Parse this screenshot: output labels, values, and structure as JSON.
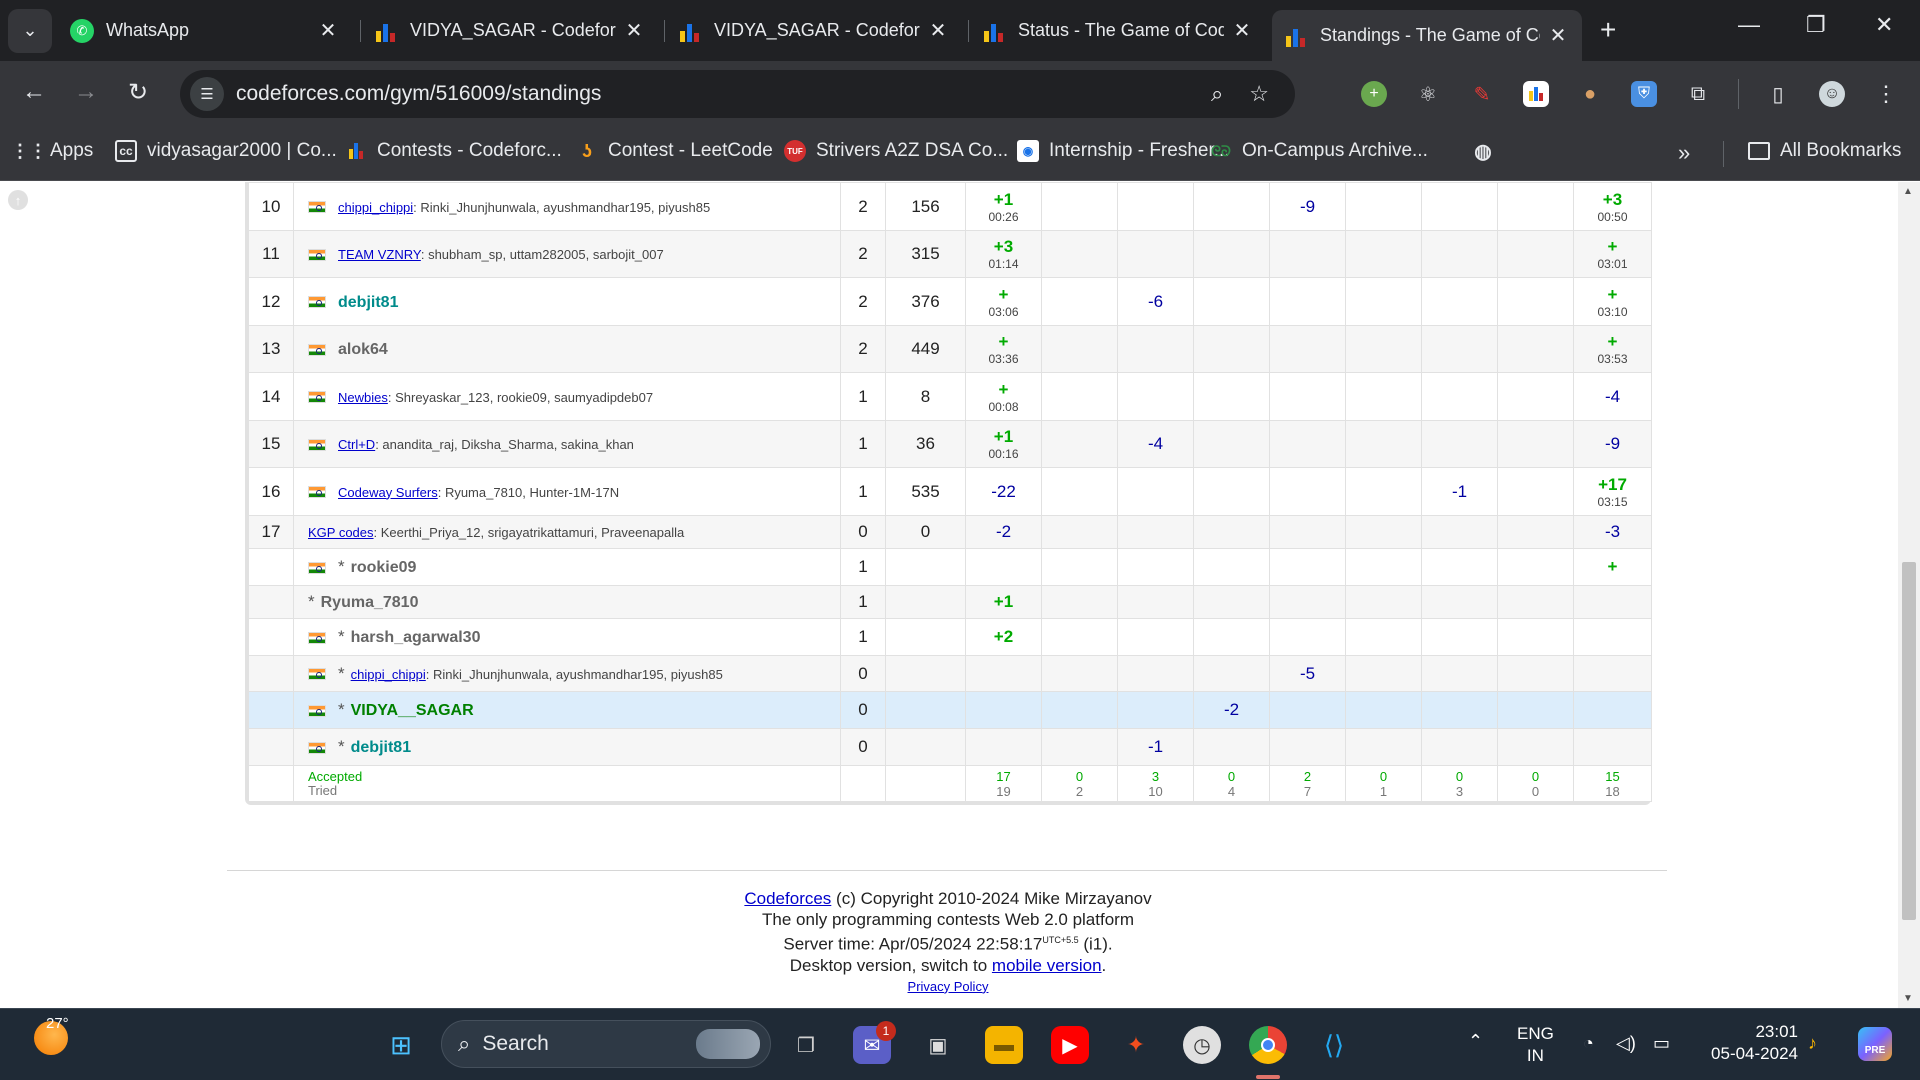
{
  "tabs": [
    {
      "title": "WhatsApp",
      "icon": "whatsapp-icon"
    },
    {
      "title": "VIDYA_SAGAR - Codeforces",
      "icon": "codeforces-icon"
    },
    {
      "title": "VIDYA_SAGAR - Codeforces",
      "icon": "codeforces-icon"
    },
    {
      "title": "Status - The Game of Code",
      "icon": "codeforces-icon"
    },
    {
      "title": "Standings - The Game of Code",
      "icon": "codeforces-icon",
      "active": true
    }
  ],
  "address": {
    "url": "codeforces.com/gym/516009/standings"
  },
  "bookmarks": [
    {
      "label": "Apps"
    },
    {
      "label": "vidyasagar2000 | Co..."
    },
    {
      "label": "Contests - Codeforc..."
    },
    {
      "label": "Contest - LeetCode"
    },
    {
      "label": "Strivers A2Z DSA Co..."
    },
    {
      "label": "Internship - Fresher..."
    },
    {
      "label": "On-Campus Archive..."
    },
    {
      "label": "All Bookmarks"
    }
  ],
  "rows": [
    {
      "rank": "10",
      "team": "chippi_chippi",
      "members": ": Rinki_Jhunjhunwala, ayushmandhar195, piyush85",
      "solved": "2",
      "penalty": "156",
      "cells": [
        {
          "v": "+1",
          "t": "00:26",
          "k": "acc"
        },
        {
          "v": "",
          "k": ""
        },
        {
          "v": "",
          "k": ""
        },
        {
          "v": "",
          "k": ""
        },
        {
          "v": "-9",
          "k": "rej"
        },
        {
          "v": "",
          "k": ""
        },
        {
          "v": "",
          "k": ""
        },
        {
          "v": "",
          "k": ""
        },
        {
          "v": "+3",
          "t": "00:50",
          "k": "acc"
        }
      ]
    },
    {
      "rank": "11",
      "team": "TEAM VZNRY",
      "members": ": shubham_sp, uttam282005, sarbojit_007",
      "solved": "2",
      "penalty": "315",
      "cells": [
        {
          "v": "+3",
          "t": "01:14",
          "k": "acc"
        },
        {
          "v": "",
          "k": ""
        },
        {
          "v": "",
          "k": ""
        },
        {
          "v": "",
          "k": ""
        },
        {
          "v": "",
          "k": ""
        },
        {
          "v": "",
          "k": ""
        },
        {
          "v": "",
          "k": ""
        },
        {
          "v": "",
          "k": ""
        },
        {
          "v": "+",
          "t": "03:01",
          "k": "acc"
        }
      ]
    },
    {
      "rank": "12",
      "handle": "debjit81",
      "solved": "2",
      "penalty": "376",
      "cells": [
        {
          "v": "+",
          "t": "03:06",
          "k": "acc"
        },
        {
          "v": "",
          "k": ""
        },
        {
          "v": "-6",
          "k": "rej"
        },
        {
          "v": "",
          "k": ""
        },
        {
          "v": "",
          "k": ""
        },
        {
          "v": "",
          "k": ""
        },
        {
          "v": "",
          "k": ""
        },
        {
          "v": "",
          "k": ""
        },
        {
          "v": "+",
          "t": "03:10",
          "k": "acc"
        }
      ]
    },
    {
      "rank": "13",
      "handle": "alok64",
      "gray": true,
      "solved": "2",
      "penalty": "449",
      "cells": [
        {
          "v": "+",
          "t": "03:36",
          "k": "acc"
        },
        {
          "v": "",
          "k": ""
        },
        {
          "v": "",
          "k": ""
        },
        {
          "v": "",
          "k": ""
        },
        {
          "v": "",
          "k": ""
        },
        {
          "v": "",
          "k": ""
        },
        {
          "v": "",
          "k": ""
        },
        {
          "v": "",
          "k": ""
        },
        {
          "v": "+",
          "t": "03:53",
          "k": "acc"
        }
      ]
    },
    {
      "rank": "14",
      "team": "Newbies",
      "members": ": Shreyaskar_123, rookie09, saumyadipdeb07",
      "solved": "1",
      "penalty": "8",
      "cells": [
        {
          "v": "+",
          "t": "00:08",
          "k": "acc"
        },
        {
          "v": "",
          "k": ""
        },
        {
          "v": "",
          "k": ""
        },
        {
          "v": "",
          "k": ""
        },
        {
          "v": "",
          "k": ""
        },
        {
          "v": "",
          "k": ""
        },
        {
          "v": "",
          "k": ""
        },
        {
          "v": "",
          "k": ""
        },
        {
          "v": "-4",
          "k": "rej"
        }
      ]
    },
    {
      "rank": "15",
      "team": "Ctrl+D",
      "members": ": anandita_raj, Diksha_Sharma, sakina_khan",
      "solved": "1",
      "penalty": "36",
      "cells": [
        {
          "v": "+1",
          "t": "00:16",
          "k": "acc"
        },
        {
          "v": "",
          "k": ""
        },
        {
          "v": "-4",
          "k": "rej"
        },
        {
          "v": "",
          "k": ""
        },
        {
          "v": "",
          "k": ""
        },
        {
          "v": "",
          "k": ""
        },
        {
          "v": "",
          "k": ""
        },
        {
          "v": "",
          "k": ""
        },
        {
          "v": "-9",
          "k": "rej"
        }
      ]
    },
    {
      "rank": "16",
      "team": "Codeway Surfers",
      "members": ": Ryuma_7810, Hunter-1M-17N",
      "solved": "1",
      "penalty": "535",
      "cells": [
        {
          "v": "-22",
          "k": "rej"
        },
        {
          "v": "",
          "k": ""
        },
        {
          "v": "",
          "k": ""
        },
        {
          "v": "",
          "k": ""
        },
        {
          "v": "",
          "k": ""
        },
        {
          "v": "",
          "k": ""
        },
        {
          "v": "-1",
          "k": "rej"
        },
        {
          "v": "",
          "k": ""
        },
        {
          "v": "+17",
          "t": "03:15",
          "k": "acc"
        }
      ]
    },
    {
      "rank": "17",
      "team": "KGP codes",
      "members": ": Keerthi_Priya_12, srigayatrikattamuri, Praveenapalla",
      "noflag": true,
      "solved": "0",
      "penalty": "0",
      "cells": [
        {
          "v": "-2",
          "k": "rej"
        },
        {
          "v": "",
          "k": ""
        },
        {
          "v": "",
          "k": ""
        },
        {
          "v": "",
          "k": ""
        },
        {
          "v": "",
          "k": ""
        },
        {
          "v": "",
          "k": ""
        },
        {
          "v": "",
          "k": ""
        },
        {
          "v": "",
          "k": ""
        },
        {
          "v": "-3",
          "k": "rej"
        }
      ]
    },
    {
      "rank": "",
      "virtual": true,
      "handle": "rookie09",
      "gray": true,
      "solved": "1",
      "penalty": "",
      "cells": [
        {
          "v": "",
          "k": ""
        },
        {
          "v": "",
          "k": ""
        },
        {
          "v": "",
          "k": ""
        },
        {
          "v": "",
          "k": ""
        },
        {
          "v": "",
          "k": ""
        },
        {
          "v": "",
          "k": ""
        },
        {
          "v": "",
          "k": ""
        },
        {
          "v": "",
          "k": ""
        },
        {
          "v": "+",
          "k": "acc"
        }
      ]
    },
    {
      "rank": "",
      "virtual": true,
      "handle": "Ryuma_7810",
      "gray": true,
      "noflag": true,
      "solved": "1",
      "penalty": "",
      "cells": [
        {
          "v": "+1",
          "k": "acc"
        },
        {
          "v": "",
          "k": ""
        },
        {
          "v": "",
          "k": ""
        },
        {
          "v": "",
          "k": ""
        },
        {
          "v": "",
          "k": ""
        },
        {
          "v": "",
          "k": ""
        },
        {
          "v": "",
          "k": ""
        },
        {
          "v": "",
          "k": ""
        },
        {
          "v": "",
          "k": ""
        }
      ]
    },
    {
      "rank": "",
      "virtual": true,
      "handle": "harsh_agarwal30",
      "gray": true,
      "solved": "1",
      "penalty": "",
      "cells": [
        {
          "v": "+2",
          "k": "acc"
        },
        {
          "v": "",
          "k": ""
        },
        {
          "v": "",
          "k": ""
        },
        {
          "v": "",
          "k": ""
        },
        {
          "v": "",
          "k": ""
        },
        {
          "v": "",
          "k": ""
        },
        {
          "v": "",
          "k": ""
        },
        {
          "v": "",
          "k": ""
        },
        {
          "v": "",
          "k": ""
        }
      ]
    },
    {
      "rank": "",
      "virtual": true,
      "team": "chippi_chippi",
      "members": ": Rinki_Jhunjhunwala, ayushmandhar195, piyush85",
      "solved": "0",
      "penalty": "",
      "cells": [
        {
          "v": "",
          "k": ""
        },
        {
          "v": "",
          "k": ""
        },
        {
          "v": "",
          "k": ""
        },
        {
          "v": "",
          "k": ""
        },
        {
          "v": "-5",
          "k": "rej"
        },
        {
          "v": "",
          "k": ""
        },
        {
          "v": "",
          "k": ""
        },
        {
          "v": "",
          "k": ""
        },
        {
          "v": "",
          "k": ""
        }
      ]
    },
    {
      "rank": "",
      "virtual": true,
      "handle": "VIDYA__SAGAR",
      "green": true,
      "highlight": true,
      "solved": "0",
      "penalty": "",
      "cells": [
        {
          "v": "",
          "k": ""
        },
        {
          "v": "",
          "k": ""
        },
        {
          "v": "",
          "k": ""
        },
        {
          "v": "-2",
          "k": "rej"
        },
        {
          "v": "",
          "k": ""
        },
        {
          "v": "",
          "k": ""
        },
        {
          "v": "",
          "k": ""
        },
        {
          "v": "",
          "k": ""
        },
        {
          "v": "",
          "k": ""
        }
      ]
    },
    {
      "rank": "",
      "virtual": true,
      "handle": "debjit81",
      "solved": "0",
      "penalty": "",
      "cells": [
        {
          "v": "",
          "k": ""
        },
        {
          "v": "",
          "k": ""
        },
        {
          "v": "-1",
          "k": "rej"
        },
        {
          "v": "",
          "k": ""
        },
        {
          "v": "",
          "k": ""
        },
        {
          "v": "",
          "k": ""
        },
        {
          "v": "",
          "k": ""
        },
        {
          "v": "",
          "k": ""
        },
        {
          "v": "",
          "k": ""
        }
      ]
    }
  ],
  "summary": {
    "accepted_label": "Accepted",
    "tried_label": "Tried",
    "accepted": [
      "17",
      "0",
      "3",
      "0",
      "2",
      "0",
      "0",
      "0",
      "15"
    ],
    "tried": [
      "19",
      "2",
      "10",
      "4",
      "7",
      "1",
      "3",
      "0",
      "18"
    ]
  },
  "footer": {
    "codeforces_link": "Codeforces",
    "copyright": " (c) Copyright 2010-2024 Mike Mirzayanov",
    "tagline": "The only programming contests Web 2.0 platform",
    "server_time_prefix": "Server time: Apr/05/2024 22:58:17",
    "utc_sup": "UTC+5.5",
    "server_time_suffix": " (i1).",
    "desktop_prefix": "Desktop version, switch to ",
    "mobile_link": "mobile version",
    "desktop_suffix": ".",
    "privacy": "Privacy Policy"
  },
  "taskbar": {
    "weather": "27°",
    "search_label": "Search",
    "notification_badge": "1",
    "lang_top": "ENG",
    "lang_bottom": "IN",
    "time": "23:01",
    "date": "05-04-2024"
  },
  "colors": {
    "accepted": "#00aa00",
    "rejected": "#0000a0",
    "highlight_row": "#dcedfb",
    "chrome_dark": "#202124",
    "chrome_toolbar": "#35363a"
  }
}
